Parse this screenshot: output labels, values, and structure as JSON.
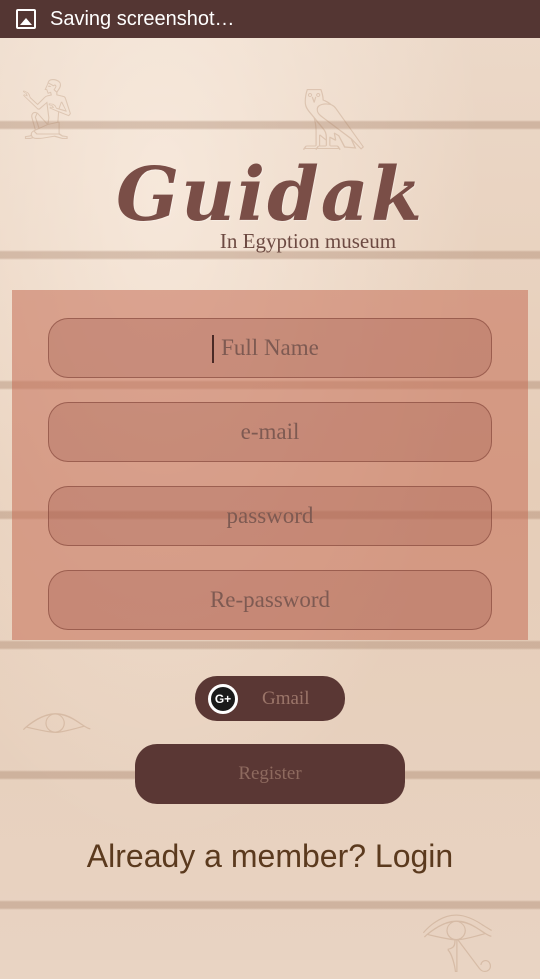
{
  "status_bar": {
    "icon": "image-icon",
    "text": "Saving screenshot…"
  },
  "logo": {
    "title": "Guidak",
    "subtitle": "In Egyption museum"
  },
  "form": {
    "full_name_placeholder": "Full Name",
    "email_placeholder": "e-mail",
    "password_placeholder": "password",
    "repassword_placeholder": "Re-password"
  },
  "gmail_button": {
    "icon": "google-plus-icon",
    "icon_glyph": "G+",
    "label": "Gmail"
  },
  "register_button": {
    "label": "Register"
  },
  "login_link": {
    "label": "Already a member? Login"
  },
  "colors": {
    "status_bar": "#543633",
    "panel": "#c46e55",
    "button": "#5a3734",
    "logo": "#7a4e47",
    "login_text": "#5b3a1e"
  }
}
